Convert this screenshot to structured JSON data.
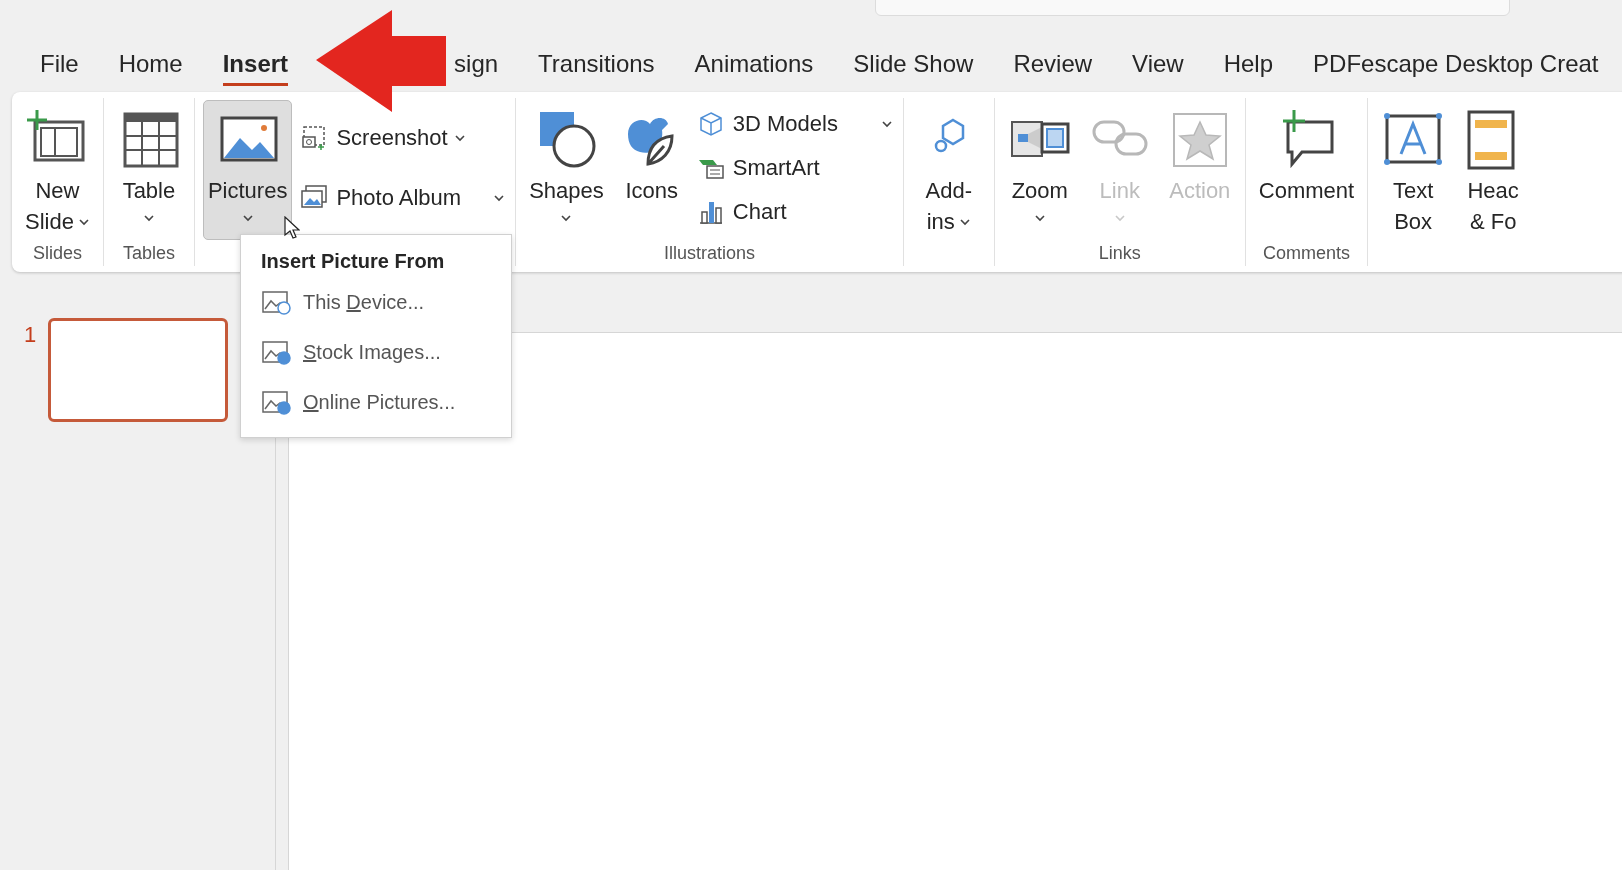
{
  "tabs": [
    {
      "label": "File",
      "selected": false
    },
    {
      "label": "Home",
      "selected": false
    },
    {
      "label": "Insert",
      "selected": true
    },
    {
      "label": "sign",
      "selected": false
    },
    {
      "label": "Transitions",
      "selected": false
    },
    {
      "label": "Animations",
      "selected": false
    },
    {
      "label": "Slide Show",
      "selected": false
    },
    {
      "label": "Review",
      "selected": false
    },
    {
      "label": "View",
      "selected": false
    },
    {
      "label": "Help",
      "selected": false
    },
    {
      "label": "PDFescape Desktop Creat",
      "selected": false
    }
  ],
  "ribbon": {
    "groups": [
      {
        "label": "Slides",
        "items": [
          {
            "kind": "large",
            "lines": [
              "New",
              "Slide"
            ],
            "caret": true,
            "disabled": false,
            "pressed": false
          }
        ]
      },
      {
        "label": "Tables",
        "items": [
          {
            "kind": "large",
            "lines": [
              "Table"
            ],
            "caret": true,
            "disabled": false,
            "pressed": false
          }
        ]
      },
      {
        "items": [
          {
            "kind": "large",
            "lines": [
              "Pictures"
            ],
            "caret": true,
            "disabled": false,
            "pressed": true
          },
          {
            "kind": "stack",
            "entries": [
              {
                "label": "Screenshot",
                "kind": "menu"
              },
              {
                "label": "Photo Album",
                "kind": "split"
              }
            ]
          }
        ]
      },
      {
        "label": "Illustrations",
        "items": [
          {
            "kind": "large",
            "lines": [
              "Shapes"
            ],
            "caret": true,
            "disabled": false,
            "pressed": false
          },
          {
            "kind": "large",
            "lines": [
              "Icons"
            ],
            "caret": false,
            "disabled": false,
            "pressed": false
          },
          {
            "kind": "stack",
            "entries": [
              {
                "label": "3D Models",
                "kind": "split"
              },
              {
                "label": "SmartArt",
                "kind": "plain"
              },
              {
                "label": "Chart",
                "kind": "plain"
              }
            ]
          }
        ]
      },
      {
        "items": [
          {
            "kind": "large",
            "lines": [
              "Add-",
              "ins"
            ],
            "caret": true,
            "disabled": false,
            "pressed": false
          }
        ]
      },
      {
        "label": "Links",
        "items": [
          {
            "kind": "large",
            "lines": [
              "Zoom"
            ],
            "caret": true,
            "disabled": false,
            "pressed": false
          },
          {
            "kind": "large",
            "lines": [
              "Link"
            ],
            "caret": true,
            "disabled": true,
            "pressed": false
          },
          {
            "kind": "large",
            "lines": [
              "Action"
            ],
            "caret": false,
            "disabled": true,
            "pressed": false
          }
        ]
      },
      {
        "label": "Comments",
        "items": [
          {
            "kind": "large",
            "lines": [
              "Comment"
            ],
            "caret": false,
            "disabled": false,
            "pressed": false
          }
        ]
      },
      {
        "items": [
          {
            "kind": "large",
            "lines": [
              "Text",
              "Box"
            ],
            "caret": false,
            "disabled": false,
            "pressed": false
          },
          {
            "kind": "large",
            "lines": [
              "Heac",
              "& Fo"
            ],
            "caret": false,
            "disabled": false,
            "pressed": false
          }
        ]
      }
    ]
  },
  "dropdown": {
    "title": "Insert Picture From",
    "items": [
      {
        "label": "This Device..."
      },
      {
        "label": "Stock Images..."
      },
      {
        "label": "Online Pictures..."
      }
    ]
  },
  "slides": [
    {
      "number": "1",
      "selected": true
    }
  ]
}
